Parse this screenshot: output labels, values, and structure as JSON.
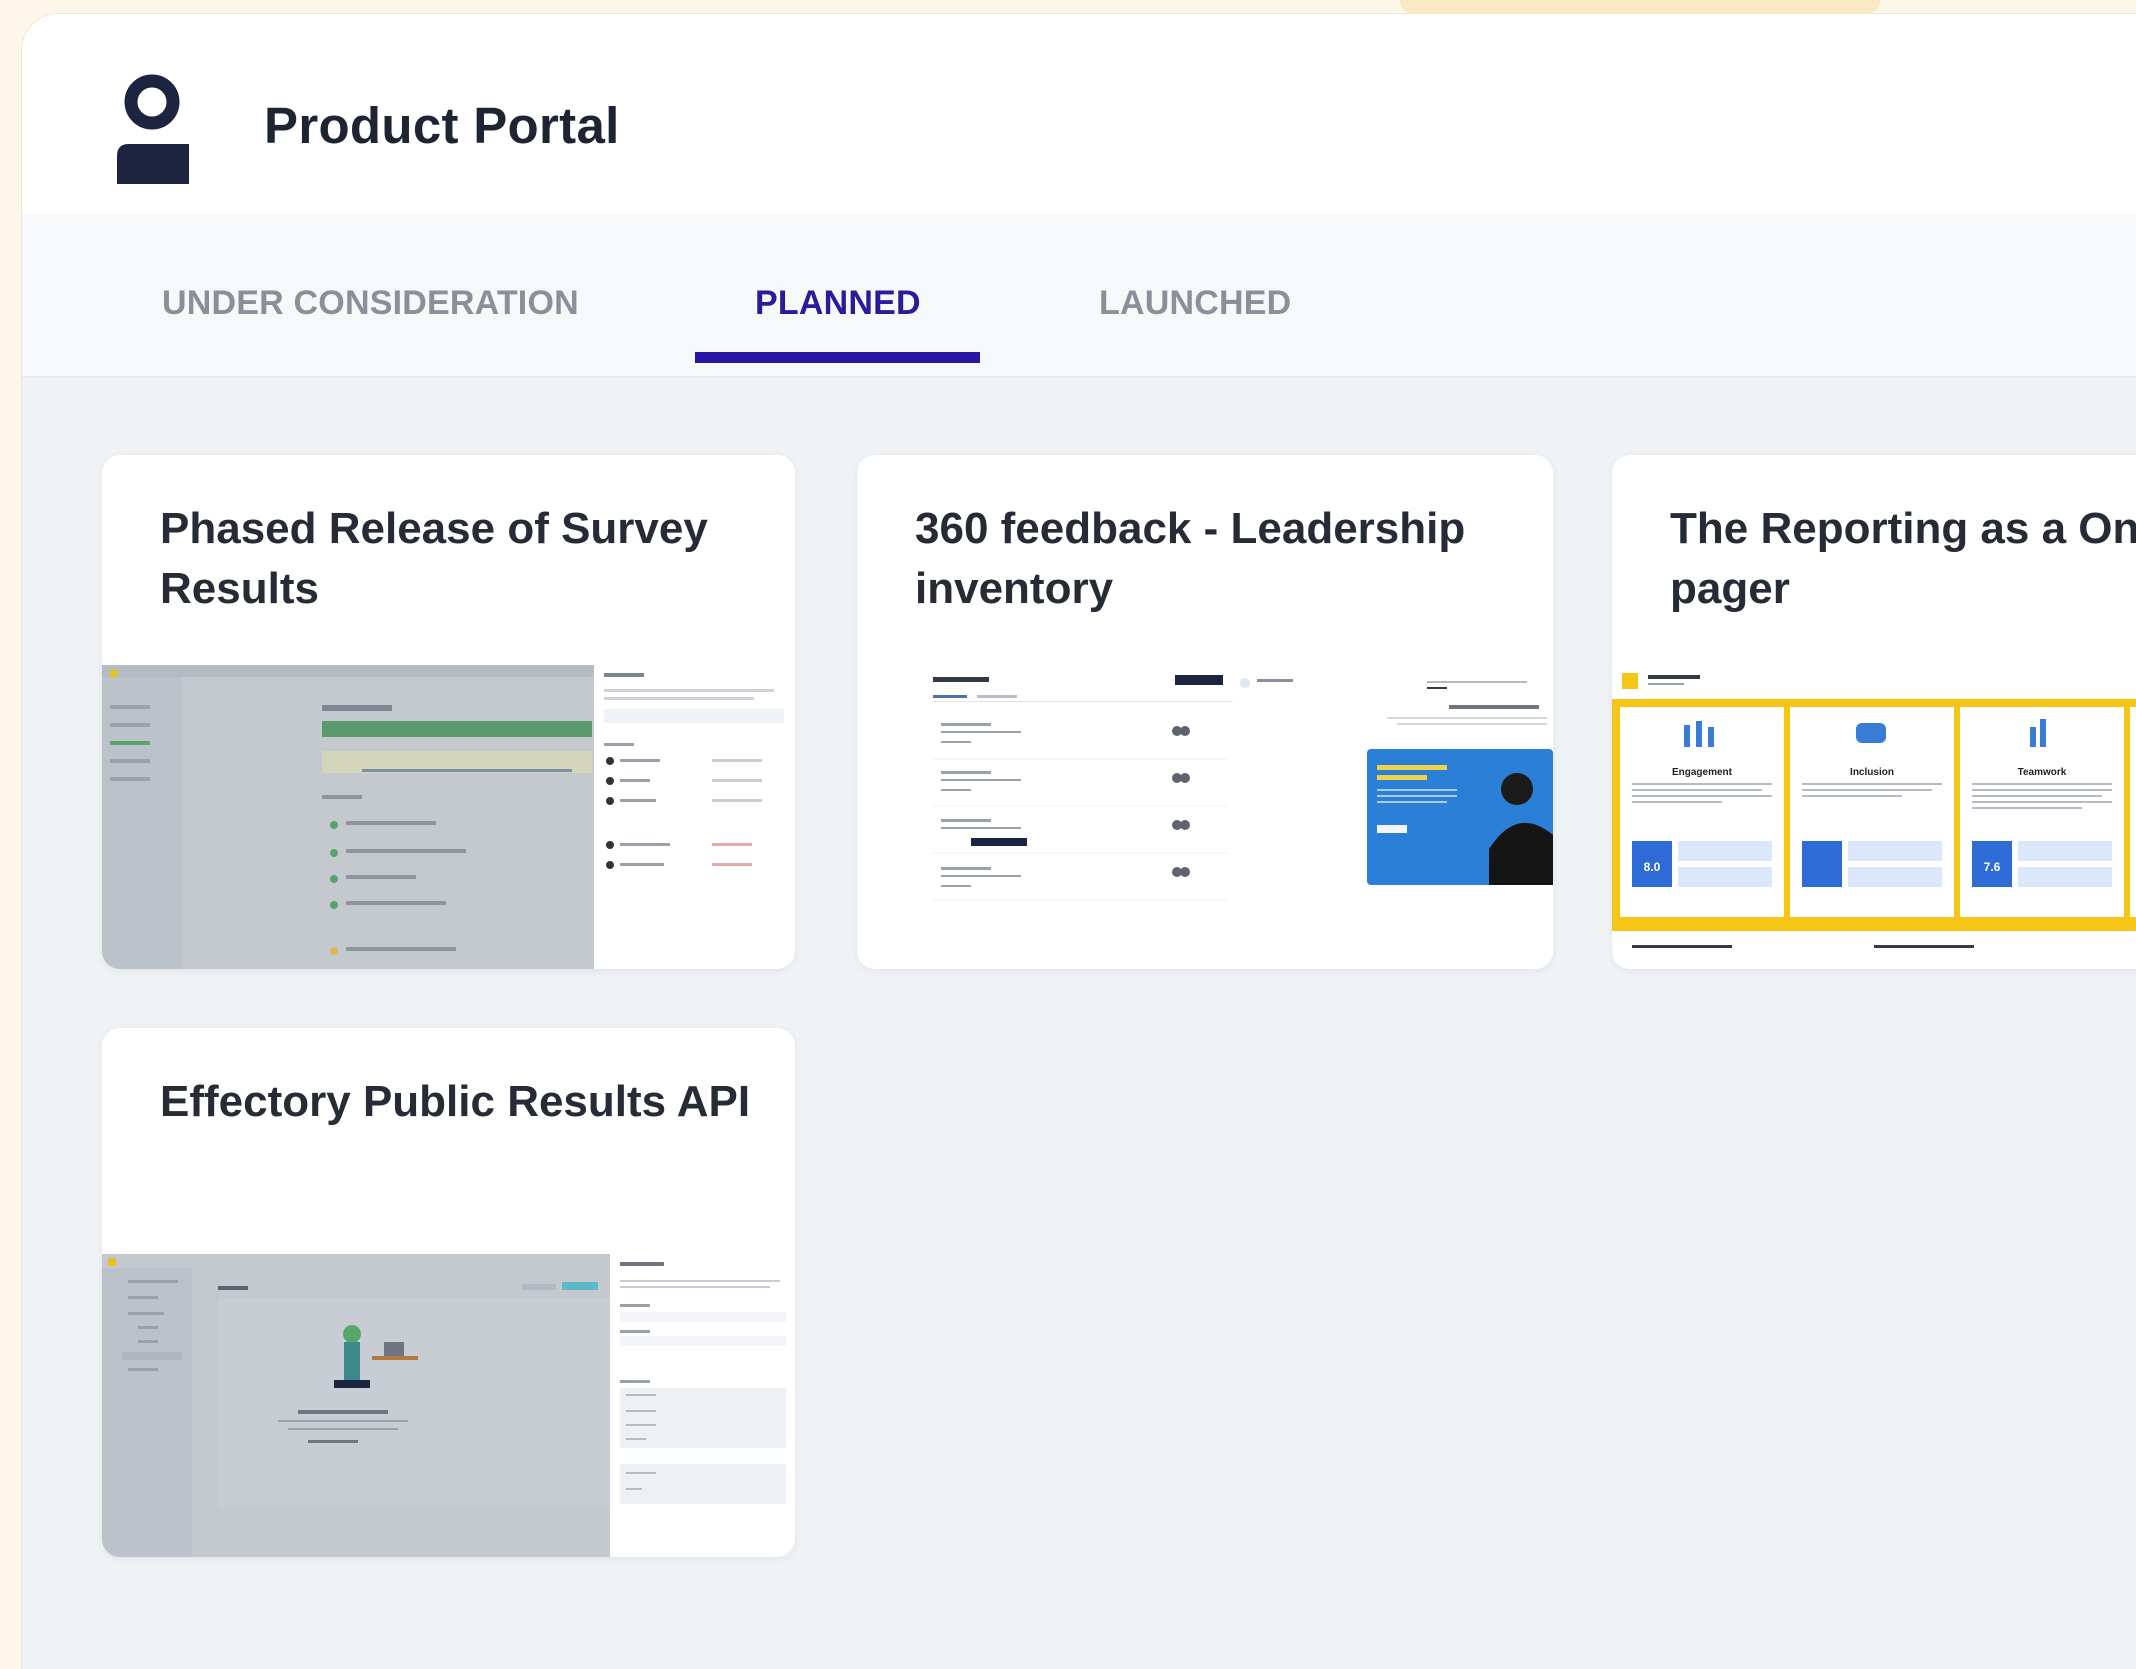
{
  "app": {
    "title": "Product Portal",
    "logo_icon": "person-logo-icon"
  },
  "tabs": [
    {
      "label": "UNDER CONSIDERATION",
      "active": false
    },
    {
      "label": "PLANNED",
      "active": true
    },
    {
      "label": "LAUNCHED",
      "active": false
    }
  ],
  "cards": [
    {
      "title": "Phased Release of Survey\nResults",
      "thumbnail": "survey-results-screenshot"
    },
    {
      "title": "360 feedback - Leadership\ninventory",
      "thumbnail": "leadership-inventory-screenshot"
    },
    {
      "title": "The Reporting as a One\npager",
      "thumbnail": "one-pager-report-screenshot",
      "thumb_labels": {
        "engagement": "Engagement",
        "inclusion": "Inclusion",
        "teamwork": "Teamwork",
        "score_1": "8.0",
        "score_3": "7.6"
      }
    },
    {
      "title": "Effectory Public Results API",
      "thumbnail": "public-results-api-screenshot"
    }
  ],
  "colors": {
    "accent": "#2815a3",
    "brand_yellow": "#f5c518",
    "navy": "#1c2440"
  }
}
